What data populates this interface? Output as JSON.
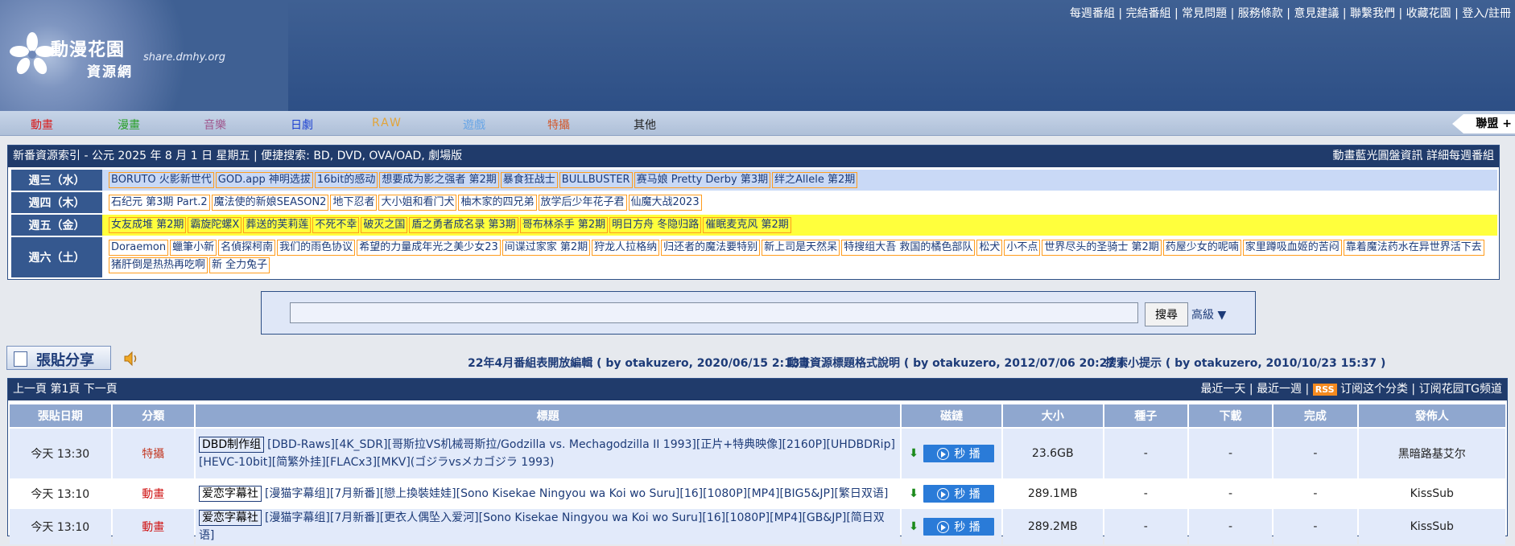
{
  "header": {
    "logo_title": "動漫花園",
    "logo_sub": "資源網",
    "logo_domain": "share.dmhy.org",
    "toplinks": [
      "每週番組",
      "完結番組",
      "常見問題",
      "服務條款",
      "意見建議",
      "聯繫我們",
      "收藏花園",
      "登入/註冊"
    ]
  },
  "nav": {
    "items": [
      {
        "label": "動畫",
        "color": "#d81e1e"
      },
      {
        "label": "漫畫",
        "color": "#2aa12a"
      },
      {
        "label": "音樂",
        "color": "#a0598f"
      },
      {
        "label": "日劇",
        "color": "#1a3fd1"
      },
      {
        "label": "RAW",
        "color": "#e2a43a"
      },
      {
        "label": "遊戲",
        "color": "#68a5e6"
      },
      {
        "label": "特攝",
        "color": "#d25a2e"
      },
      {
        "label": "其他",
        "color": "#222222"
      }
    ],
    "lianmeng": "聯盟 +"
  },
  "schedule": {
    "header": "新番資源索引 - 公元 2025 年 8 月 1 日 星期五 | 便捷搜索: BD, DVD, OVA/OAD, 劇場版",
    "header_right": "動畫藍光圓盤資訊 詳細每週番組",
    "days": [
      {
        "day": "週三（水）",
        "bg": "#c9d9f6",
        "titles": [
          "BORUTO 火影新世代",
          "GOD.app 神明选拔",
          "16bit的感动",
          "想要成为影之强者 第2期",
          "暴食狂战士",
          "BULLBUSTER",
          "赛马娘 Pretty Derby 第3期",
          "绊之Allele 第2期"
        ]
      },
      {
        "day": "週四（木）",
        "bg": "#ffffff",
        "titles": [
          "石纪元 第3期 Part.2",
          "魔法使的新娘SEASON2",
          "地下忍者",
          "大小姐和看门犬",
          "柚木家的四兄弟",
          "放学后少年花子君",
          "仙魔大战2023"
        ]
      },
      {
        "day": "週五（金）",
        "bg": "#ffff3c",
        "titles": [
          "女友成堆 第2期",
          "霸旋陀螺X",
          "葬送的芙莉莲",
          "不死不幸",
          "破灭之国",
          "盾之勇者成名录 第3期",
          "哥布林杀手 第2期",
          "明日方舟 冬隐归路",
          "催眠麦克风 第2期"
        ]
      },
      {
        "day": "週六（土）",
        "bg": "#ffffff",
        "titles": [
          "Doraemon",
          "蠟筆小新",
          "名偵探柯南",
          "我们的雨色协议",
          "希望的力量成年光之美少女23",
          "间谍过家家 第2期",
          "狩龙人拉格纳",
          "归还者的魔法要特别",
          "新上司是天然呆",
          "特搜组大吾 救国的橘色部队",
          "松犬",
          "小不点",
          "世界尽头的圣骑士 第2期",
          "药屋少女的呢喃",
          "家里蹲吸血姬的苦闷",
          "靠着魔法药水在异世界活下去",
          "猪肝倒是热热再吃啊",
          "新 全力兔子"
        ]
      }
    ]
  },
  "search": {
    "button": "搜尋",
    "advanced": "高級 ▼",
    "value": ""
  },
  "post": {
    "button": "張貼分享"
  },
  "announcements": [
    "22年4月番組表開放編輯 ( by otakuzero, 2020/06/15 2:13 )",
    "動畫資源標題格式說明 ( by otakuzero, 2012/07/06 20:27 )",
    "搜索小提示 ( by otakuzero, 2010/10/23 15:37 )"
  ],
  "list": {
    "pager": "上一頁 第1頁 下一頁",
    "right_links": [
      "最近一天",
      "最近一週"
    ],
    "rss_badge": "RSS",
    "subscribe": "订阅这个分类",
    "tg": "订阅花园TG频道",
    "columns": [
      "張貼日期",
      "分類",
      "標題",
      "磁鏈",
      "大小",
      "種子",
      "下載",
      "完成",
      "發佈人"
    ],
    "play_label": "秒 播",
    "rows": [
      {
        "date": "今天 13:30",
        "category": "特攝",
        "cat_color": "#c33a24",
        "team": "DBD制作组",
        "title": "[DBD-Raws][4K_SDR][哥斯拉VS机械哥斯拉/Godzilla vs. Mechagodzilla II 1993][正片+特典映像][2160P][UHDBDRip][HEVC-10bit][简繁外挂][FLACx3][MKV](ゴジラvsメカゴジラ 1993)",
        "size": "23.6GB",
        "seeds": "-",
        "downloads": "-",
        "complete": "-",
        "publisher": "黑暗路基艾尔"
      },
      {
        "date": "今天 13:10",
        "category": "動畫",
        "cat_color": "#d01717",
        "team": "爱恋字幕社",
        "title": "[漫猫字幕组][7月新番][戀上換裝娃娃][Sono Kisekae Ningyou wa Koi wo Suru][16][1080P][MP4][BIG5&JP][繁日双语]",
        "size": "289.1MB",
        "seeds": "-",
        "downloads": "-",
        "complete": "-",
        "publisher": "KissSub"
      },
      {
        "date": "今天 13:10",
        "category": "動畫",
        "cat_color": "#d01717",
        "team": "爱恋字幕社",
        "title": "[漫猫字幕组][7月新番][更衣人偶坠入爱河][Sono Kisekae Ningyou wa Koi wo Suru][16][1080P][MP4][GB&JP][简日双语]",
        "size": "289.2MB",
        "seeds": "-",
        "downloads": "-",
        "complete": "-",
        "publisher": "KissSub"
      }
    ]
  }
}
